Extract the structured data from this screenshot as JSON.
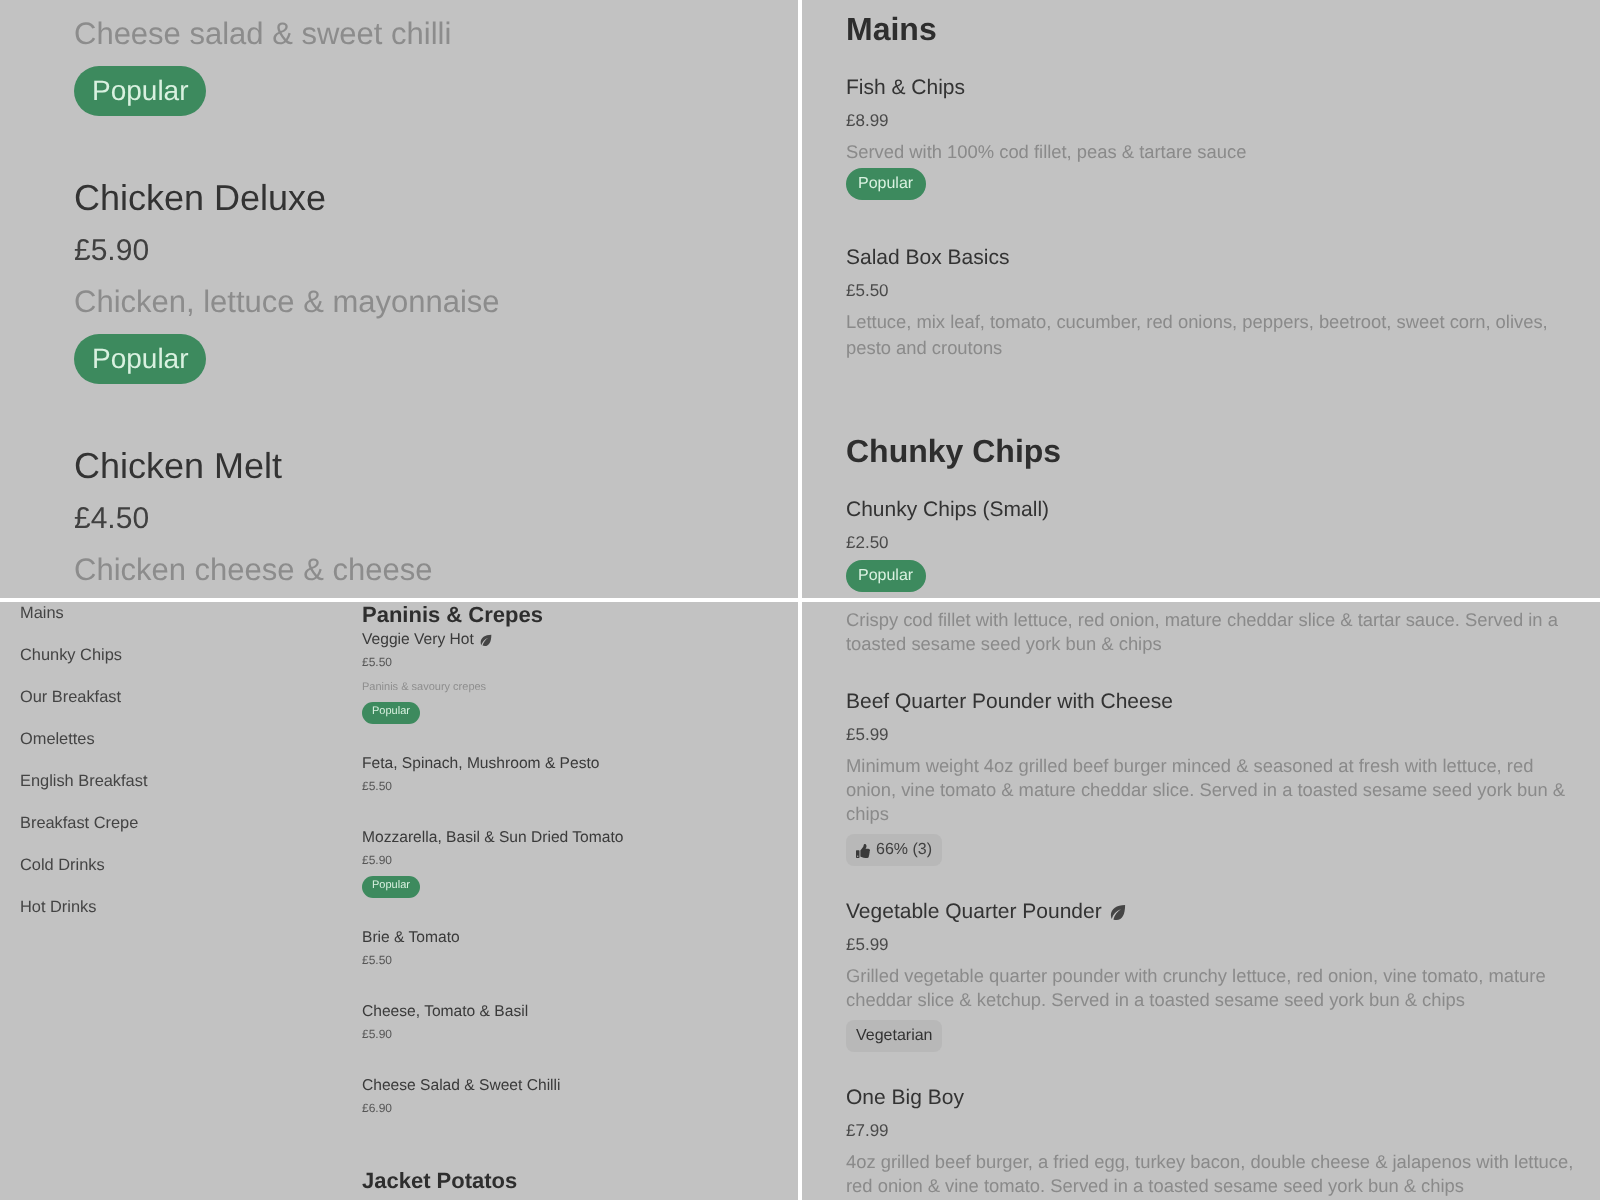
{
  "panels": [
    {
      "kind": "large",
      "sections": [
        {
          "items": [
            {
              "description": "Cheese salad & sweet chilli",
              "leaf": false,
              "badges": [
                {
                  "kind": "popular",
                  "label": "Popular"
                }
              ]
            },
            {
              "name": "Chicken Deluxe",
              "price": "£5.90",
              "description": "Chicken, lettuce & mayonnaise",
              "leaf": false,
              "badges": [
                {
                  "kind": "popular",
                  "label": "Popular"
                }
              ]
            },
            {
              "name": "Chicken Melt",
              "price": "£4.50",
              "description": "Chicken cheese & cheese",
              "leaf": false
            }
          ]
        }
      ]
    },
    {
      "kind": "medium",
      "sections": [
        {
          "heading": "Mains",
          "items": [
            {
              "name": "Fish & Chips",
              "price": "£8.99",
              "description": "Served with 100% cod fillet, peas & tartare sauce",
              "leaf": false,
              "badges": [
                {
                  "kind": "popular",
                  "label": "Popular"
                }
              ]
            },
            {
              "name": "Salad Box Basics",
              "price": "£5.50",
              "description": "Lettuce, mix leaf, tomato, cucumber, red onions, peppers, beetroot, sweet corn, olives, pesto and croutons",
              "leaf": false
            }
          ]
        },
        {
          "heading": "Chunky Chips",
          "items": [
            {
              "name": "Chunky Chips (Small)",
              "price": "£2.50",
              "leaf": false,
              "badges": [
                {
                  "kind": "popular",
                  "label": "Popular"
                }
              ]
            }
          ]
        }
      ]
    },
    {
      "kind": "small",
      "sidebar": {
        "items": [
          {
            "label": "Mains"
          },
          {
            "label": "Chunky Chips"
          },
          {
            "label": "Our Breakfast"
          },
          {
            "label": "Omelettes"
          },
          {
            "label": "English Breakfast"
          },
          {
            "label": "Breakfast Crepe"
          },
          {
            "label": "Cold Drinks"
          },
          {
            "label": "Hot Drinks"
          }
        ]
      },
      "sections": [
        {
          "heading": "Paninis & Crepes",
          "items": [
            {
              "name": "Veggie Very Hot",
              "price": "£5.50",
              "description": "Paninis & savoury crepes",
              "leaf": true,
              "badges": [
                {
                  "kind": "popular",
                  "label": "Popular"
                }
              ]
            },
            {
              "name": "Feta, Spinach, Mushroom & Pesto",
              "price": "£5.50",
              "leaf": false
            },
            {
              "name": "Mozzarella, Basil & Sun Dried Tomato",
              "price": "£5.90",
              "leaf": false,
              "badges": [
                {
                  "kind": "popular",
                  "label": "Popular"
                }
              ]
            },
            {
              "name": "Brie & Tomato",
              "price": "£5.50",
              "leaf": false
            },
            {
              "name": "Cheese, Tomato & Basil",
              "price": "£5.90",
              "leaf": false
            },
            {
              "name": "Cheese Salad & Sweet Chilli",
              "price": "£6.90",
              "leaf": false
            }
          ]
        },
        {
          "heading": "Jacket Potatos"
        }
      ]
    },
    {
      "kind": "compact",
      "sections": [
        {
          "items": [
            {
              "description": "Crispy cod fillet with lettuce, red onion, mature cheddar slice & tartar sauce. Served in a toasted sesame seed york bun & chips",
              "leaf": false
            },
            {
              "name": "Beef Quarter Pounder with Cheese",
              "price": "£5.99",
              "description": "Minimum weight 4oz grilled beef burger minced & seasoned at fresh with lettuce, red onion, vine tomato & mature cheddar slice. Served in a toasted sesame seed york bun & chips",
              "leaf": false,
              "badges": [
                {
                  "kind": "rating",
                  "label": "66% (3)"
                }
              ]
            },
            {
              "name": "Vegetable Quarter Pounder",
              "price": "£5.99",
              "description": "Grilled vegetable quarter pounder with crunchy lettuce, red onion, vine tomato, mature cheddar slice & ketchup. Served in a toasted sesame seed york bun & chips",
              "leaf": true,
              "badges": [
                {
                  "kind": "tag",
                  "label": "Vegetarian"
                }
              ]
            },
            {
              "name": "One Big Boy",
              "price": "£7.99",
              "description": "4oz grilled beef burger, a fried egg, turkey bacon, double cheese & jalapenos with lettuce, red onion & vine tomato. Served in a toasted sesame seed york bun & chips",
              "leaf": false
            }
          ]
        }
      ]
    }
  ]
}
